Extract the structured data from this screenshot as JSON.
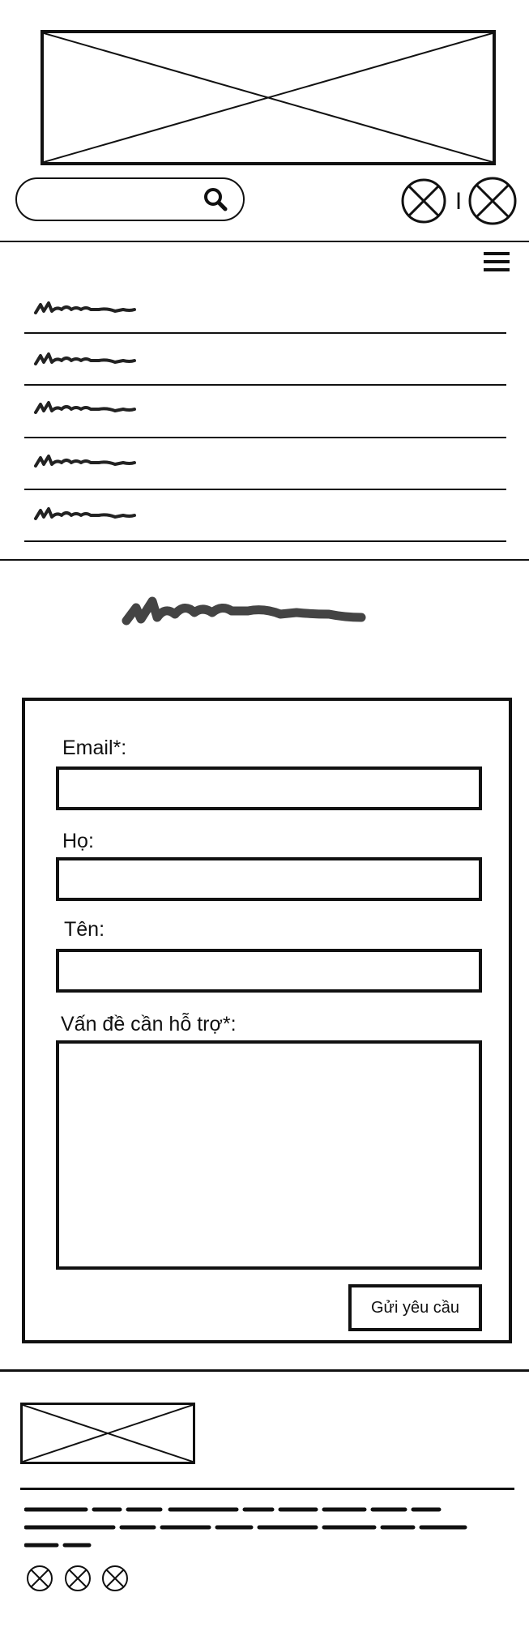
{
  "header": {
    "banner_image": "image-placeholder",
    "search": {
      "icon": "search-icon",
      "value": ""
    },
    "account_icons": [
      "placeholder-icon",
      "placeholder-icon"
    ],
    "separator": "I"
  },
  "nav": {
    "menu_icon": "hamburger-menu-icon",
    "items": [
      "scribble-text",
      "scribble-text",
      "scribble-text",
      "scribble-text",
      "scribble-text"
    ]
  },
  "page": {
    "title": "scribble-heading"
  },
  "form": {
    "email_label": "Email*:",
    "email_value": "",
    "last_name_label": "Họ:",
    "last_name_value": "",
    "first_name_label": "Tên:",
    "first_name_value": "",
    "issue_label": "Vấn đề cần hỗ trợ*:",
    "issue_value": "",
    "submit_label": "Gửi yêu cầu"
  },
  "footer": {
    "logo": "image-placeholder",
    "social_icons": [
      "placeholder-icon",
      "placeholder-icon",
      "placeholder-icon"
    ]
  }
}
